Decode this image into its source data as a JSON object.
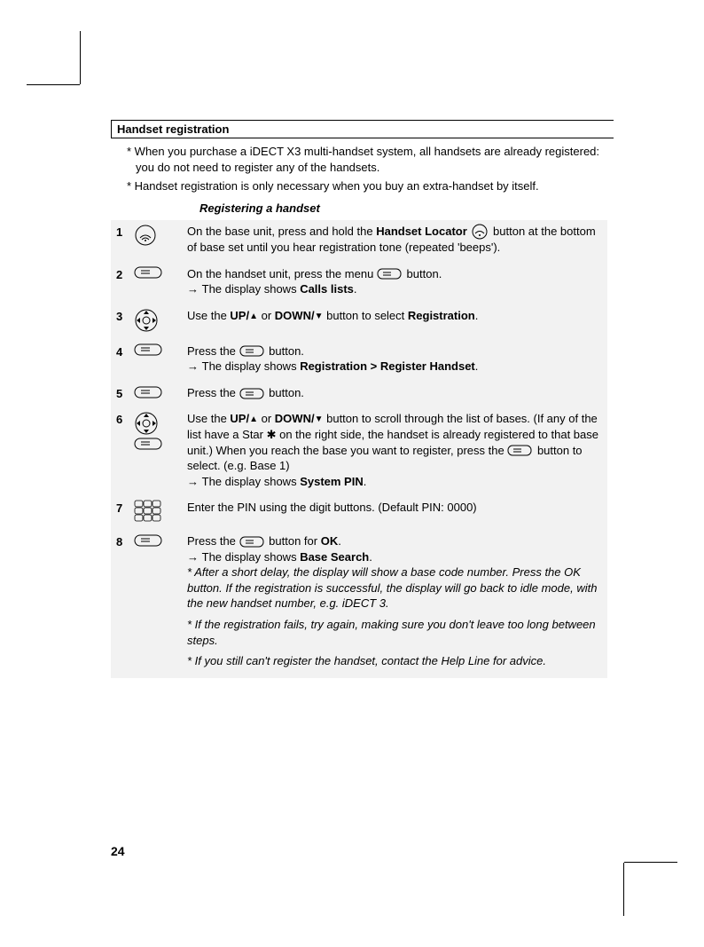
{
  "header": "Handset registration",
  "intro1": "* When you purchase a iDECT X3 multi-handset system, all handsets are already registered: you do not need to register any of the handsets.",
  "intro2": "* Handset registration is only necessary when you buy an extra-handset by itself.",
  "subheading": "Registering a handset",
  "steps": {
    "s1": {
      "num": "1",
      "text_a": "On the base unit, press and hold the ",
      "bold_a": "Handset Locator",
      "text_b": " button at the bottom of base set until you hear registration tone (repeated 'beeps')."
    },
    "s2": {
      "num": "2",
      "text_a": "On the handset unit, press the menu ",
      "text_b": " button.",
      "result": "The display shows ",
      "result_bold": "Calls lists",
      "result_end": "."
    },
    "s3": {
      "num": "3",
      "text_a": "Use the ",
      "bold_a": "UP/",
      "text_b": "or ",
      "bold_b": "DOWN/",
      "text_c": "button to select ",
      "bold_c": "Registration",
      "text_d": "."
    },
    "s4": {
      "num": "4",
      "text_a": "Press the ",
      "text_b": " button.",
      "result": "The display shows ",
      "result_bold": "Registration > Register Handset",
      "result_end": "."
    },
    "s5": {
      "num": "5",
      "text_a": "Press the ",
      "text_b": " button."
    },
    "s6": {
      "num": "6",
      "text_a": "Use the ",
      "bold_a": "UP/",
      "text_b": "or ",
      "bold_b": "DOWN/",
      "text_c": "button to scroll through the list of bases. (If any of the list have a Star ✱ on the right side, the handset is already registered to that base unit.) When you reach the base you want to register, press the ",
      "text_d": " button to select. (e.g. Base 1)",
      "result": "The display shows ",
      "result_bold": "System PIN",
      "result_end": "."
    },
    "s7": {
      "num": "7",
      "text": "Enter the PIN using the digit buttons. (Default PIN: 0000)"
    },
    "s8": {
      "num": "8",
      "text_a": "Press the ",
      "text_b": " button for ",
      "bold_a": "OK",
      "text_c": ".",
      "result": "The display shows ",
      "result_bold": "Base Search",
      "result_end": ".",
      "note1": "* After a short delay, the display will show a base code number. Press the OK button. If the registration is successful, the display will go back to idle mode, with the new handset number, e.g. iDECT 3.",
      "note2": "* If the registration fails, try again, making sure you don't leave too long between steps.",
      "note3": "* If you still can't register the handset, contact the Help Line for advice."
    }
  },
  "pagenum": "24"
}
